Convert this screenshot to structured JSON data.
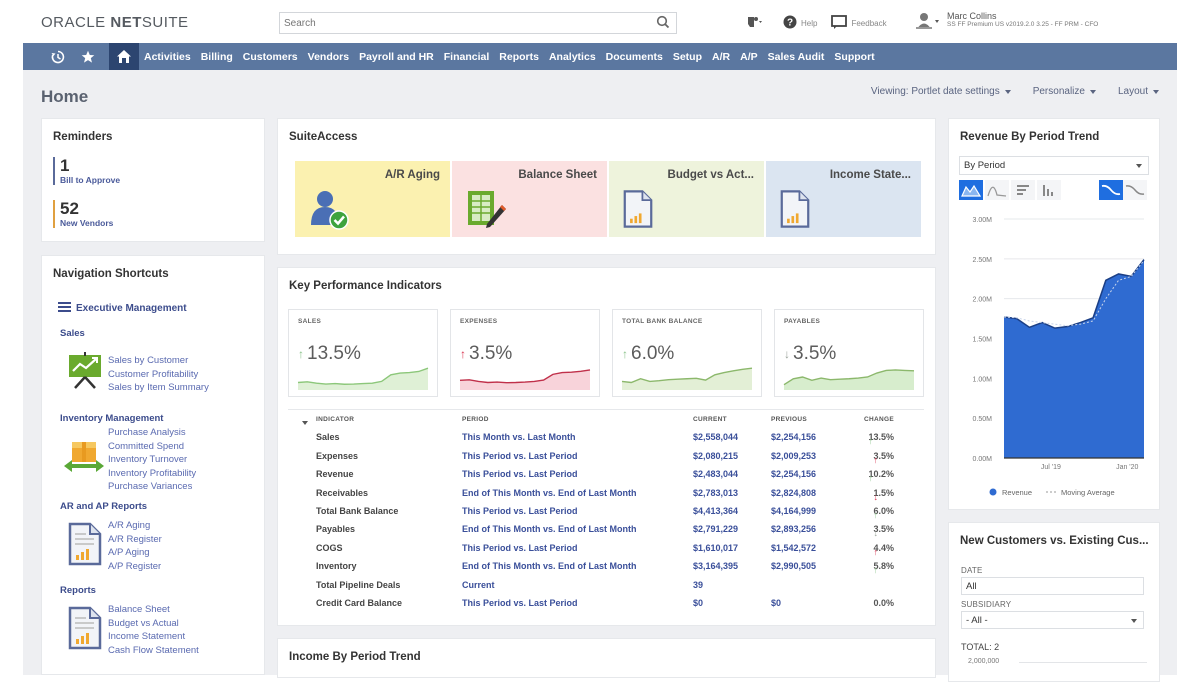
{
  "header": {
    "logo_brand": "ORACLE",
    "logo_product_bold": "NET",
    "logo_product_light": "SUITE",
    "search_placeholder": "Search",
    "help_label": "Help",
    "feedback_label": "Feedback",
    "user_name": "Marc Collins",
    "user_role": "SS FF Premium US v2019.2.0 3.25 - FF PRM - CFO"
  },
  "nav": {
    "icons": [
      "recent-history-icon",
      "star-icon",
      "home-icon"
    ],
    "items": [
      "Activities",
      "Billing",
      "Customers",
      "Vendors",
      "Payroll and HR",
      "Financial",
      "Reports",
      "Analytics",
      "Documents",
      "Setup",
      "A/R",
      "A/P",
      "Sales Audit",
      "Support"
    ]
  },
  "page": {
    "title": "Home",
    "options": [
      "Viewing: Portlet date settings",
      "Personalize",
      "Layout"
    ]
  },
  "reminders": {
    "title": "Reminders",
    "items": [
      {
        "count": "1",
        "label": "Bill to Approve",
        "color": "#5a6a9a"
      },
      {
        "count": "52",
        "label": "New Vendors",
        "color": "#e0a040"
      }
    ]
  },
  "shortcuts": {
    "title": "Navigation Shortcuts",
    "menu_label": "Executive Management",
    "sections": [
      {
        "title": "Sales",
        "icon": "sales-chart-icon",
        "links": [
          "Sales by Customer",
          "Customer Profitability",
          "Sales by Item Summary"
        ]
      },
      {
        "title": "Inventory Management",
        "icon": "inventory-box-icon",
        "links": [
          "Purchase Analysis",
          "Committed Spend",
          "Inventory Turnover",
          "Inventory Profitability",
          "Purchase Variances"
        ]
      },
      {
        "title": "AR and AP Reports",
        "icon": "report-document-icon",
        "links": [
          "A/R Aging",
          "A/R Register",
          "A/P Aging",
          "A/P Register"
        ]
      },
      {
        "title": "Reports",
        "icon": "report-document-icon",
        "links": [
          "Balance Sheet",
          "Budget vs Actual",
          "Income Statement",
          "Cash Flow Statement"
        ]
      }
    ]
  },
  "suite_access": {
    "title": "SuiteAccess",
    "tiles": [
      {
        "label": "A/R Aging",
        "color": "#fbf1b0",
        "icon": "user-check-icon"
      },
      {
        "label": "Balance Sheet",
        "color": "#fbe1e1",
        "icon": "spreadsheet-edit-icon"
      },
      {
        "label": "Budget vs Act...",
        "color": "#eef3dc",
        "icon": "report-document-icon"
      },
      {
        "label": "Income State...",
        "color": "#dbe5f1",
        "icon": "report-document-icon"
      }
    ]
  },
  "kpi": {
    "title": "Key Performance Indicators",
    "cards": [
      {
        "label": "SALES",
        "value": "13.5%",
        "direction": "up",
        "arrow_color": "#8bc38b",
        "line_color": "#8cc77a",
        "fill_color": "#dff0d6",
        "trend": [
          0.25,
          0.28,
          0.22,
          0.18,
          0.2,
          0.17,
          0.18,
          0.2,
          0.22,
          0.3,
          0.6,
          0.68,
          0.7,
          0.75,
          0.9
        ]
      },
      {
        "label": "EXPENSES",
        "value": "3.5%",
        "direction": "up",
        "arrow_color": "#d9334f",
        "line_color": "#c0304a",
        "fill_color": "#f8d3da",
        "trend": [
          0.35,
          0.37,
          0.3,
          0.25,
          0.27,
          0.24,
          0.25,
          0.27,
          0.3,
          0.36,
          0.62,
          0.7,
          0.72,
          0.76,
          0.82
        ]
      },
      {
        "label": "TOTAL BANK BALANCE",
        "value": "6.0%",
        "direction": "up",
        "arrow_color": "#8bc38b",
        "line_color": "#8cb86c",
        "fill_color": "#e3efd6",
        "trend": [
          0.3,
          0.25,
          0.42,
          0.3,
          0.33,
          0.38,
          0.4,
          0.42,
          0.44,
          0.36,
          0.6,
          0.7,
          0.78,
          0.85,
          0.9
        ]
      },
      {
        "label": "PAYABLES",
        "value": "3.5%",
        "direction": "down",
        "arrow_color": "#9aa39a",
        "line_color": "#8cb86c",
        "fill_color": "#d7edcd",
        "trend": [
          0.15,
          0.42,
          0.5,
          0.35,
          0.45,
          0.38,
          0.4,
          0.42,
          0.45,
          0.5,
          0.68,
          0.8,
          0.82,
          0.8,
          0.78
        ]
      }
    ],
    "table": {
      "headers": [
        "INDICATOR",
        "PERIOD",
        "CURRENT",
        "PREVIOUS",
        "CHANGE"
      ],
      "rows": [
        {
          "indicator": "Sales",
          "period": "This Month vs. Last Month",
          "current": "$2,558,044",
          "previous": "$2,254,156",
          "change": "13.5%",
          "arrow": "up-green"
        },
        {
          "indicator": "Expenses",
          "period": "This Period vs. Last Period",
          "current": "$2,080,215",
          "previous": "$2,009,253",
          "change": "3.5%",
          "arrow": "up-red"
        },
        {
          "indicator": "Revenue",
          "period": "This Period vs. Last Period",
          "current": "$2,483,044",
          "previous": "$2,254,156",
          "change": "10.2%",
          "arrow": "up-green"
        },
        {
          "indicator": "Receivables",
          "period": "End of This Month vs. End of Last Month",
          "current": "$2,783,013",
          "previous": "$2,824,808",
          "change": "1.5%",
          "arrow": "down-red"
        },
        {
          "indicator": "Total Bank Balance",
          "period": "This Period vs. Last Period",
          "current": "$4,413,364",
          "previous": "$4,164,999",
          "change": "6.0%",
          "arrow": "up-green"
        },
        {
          "indicator": "Payables",
          "period": "End of This Month vs. End of Last Month",
          "current": "$2,791,229",
          "previous": "$2,893,256",
          "change": "3.5%",
          "arrow": "down-gray"
        },
        {
          "indicator": "COGS",
          "period": "This Period vs. Last Period",
          "current": "$1,610,017",
          "previous": "$1,542,572",
          "change": "4.4%",
          "arrow": "up-red"
        },
        {
          "indicator": "Inventory",
          "period": "End of This Month vs. End of Last Month",
          "current": "$3,164,395",
          "previous": "$2,990,505",
          "change": "5.8%",
          "arrow": "up-green"
        },
        {
          "indicator": "Total Pipeline Deals",
          "period": "Current",
          "current": "39",
          "previous": "",
          "change": "",
          "arrow": ""
        },
        {
          "indicator": "Credit Card Balance",
          "period": "This Period vs. Last Period",
          "current": "$0",
          "previous": "$0",
          "change": "0.0%",
          "arrow": ""
        }
      ]
    }
  },
  "income_trend": {
    "title": "Income By Period Trend"
  },
  "revenue_trend": {
    "title": "Revenue By Period Trend",
    "select_value": "By Period",
    "chart_data": {
      "type": "area",
      "title": "Revenue By Period Trend",
      "ylim": [
        0,
        3000000
      ],
      "yticks": [
        "0.00M",
        "0.50M",
        "1.00M",
        "1.50M",
        "2.00M",
        "2.50M",
        "3.00M"
      ],
      "ytick_values": [
        0,
        500000,
        1000000,
        1500000,
        2000000,
        2500000,
        3000000
      ],
      "xtick_labels": [
        "Jul '19",
        "Jan '20"
      ],
      "xtick_index": [
        4,
        10
      ],
      "series": [
        {
          "name": "Revenue",
          "color": "#2f6bd1",
          "values": [
            1770000,
            1750000,
            1640000,
            1700000,
            1630000,
            1650000,
            1700000,
            1760000,
            2230000,
            2310000,
            2280000,
            2490000
          ]
        },
        {
          "name": "Moving Average",
          "style": "dashed",
          "values": [
            1770000,
            1760000,
            1720000,
            1700000,
            1680000,
            1660000,
            1680000,
            1720000,
            2000000,
            2230000,
            2280000,
            2480000
          ]
        }
      ],
      "legend": [
        "Revenue",
        "Moving Average"
      ],
      "legend_position": "bottom",
      "grid": true
    }
  },
  "new_customers": {
    "title": "New Customers vs. Existing Cus...",
    "date_label": "DATE",
    "date_value": "All",
    "subsidiary_label": "SUBSIDIARY",
    "subsidiary_value": "- All -",
    "total_label": "TOTAL: 2",
    "first_tick": "2,000,000"
  }
}
